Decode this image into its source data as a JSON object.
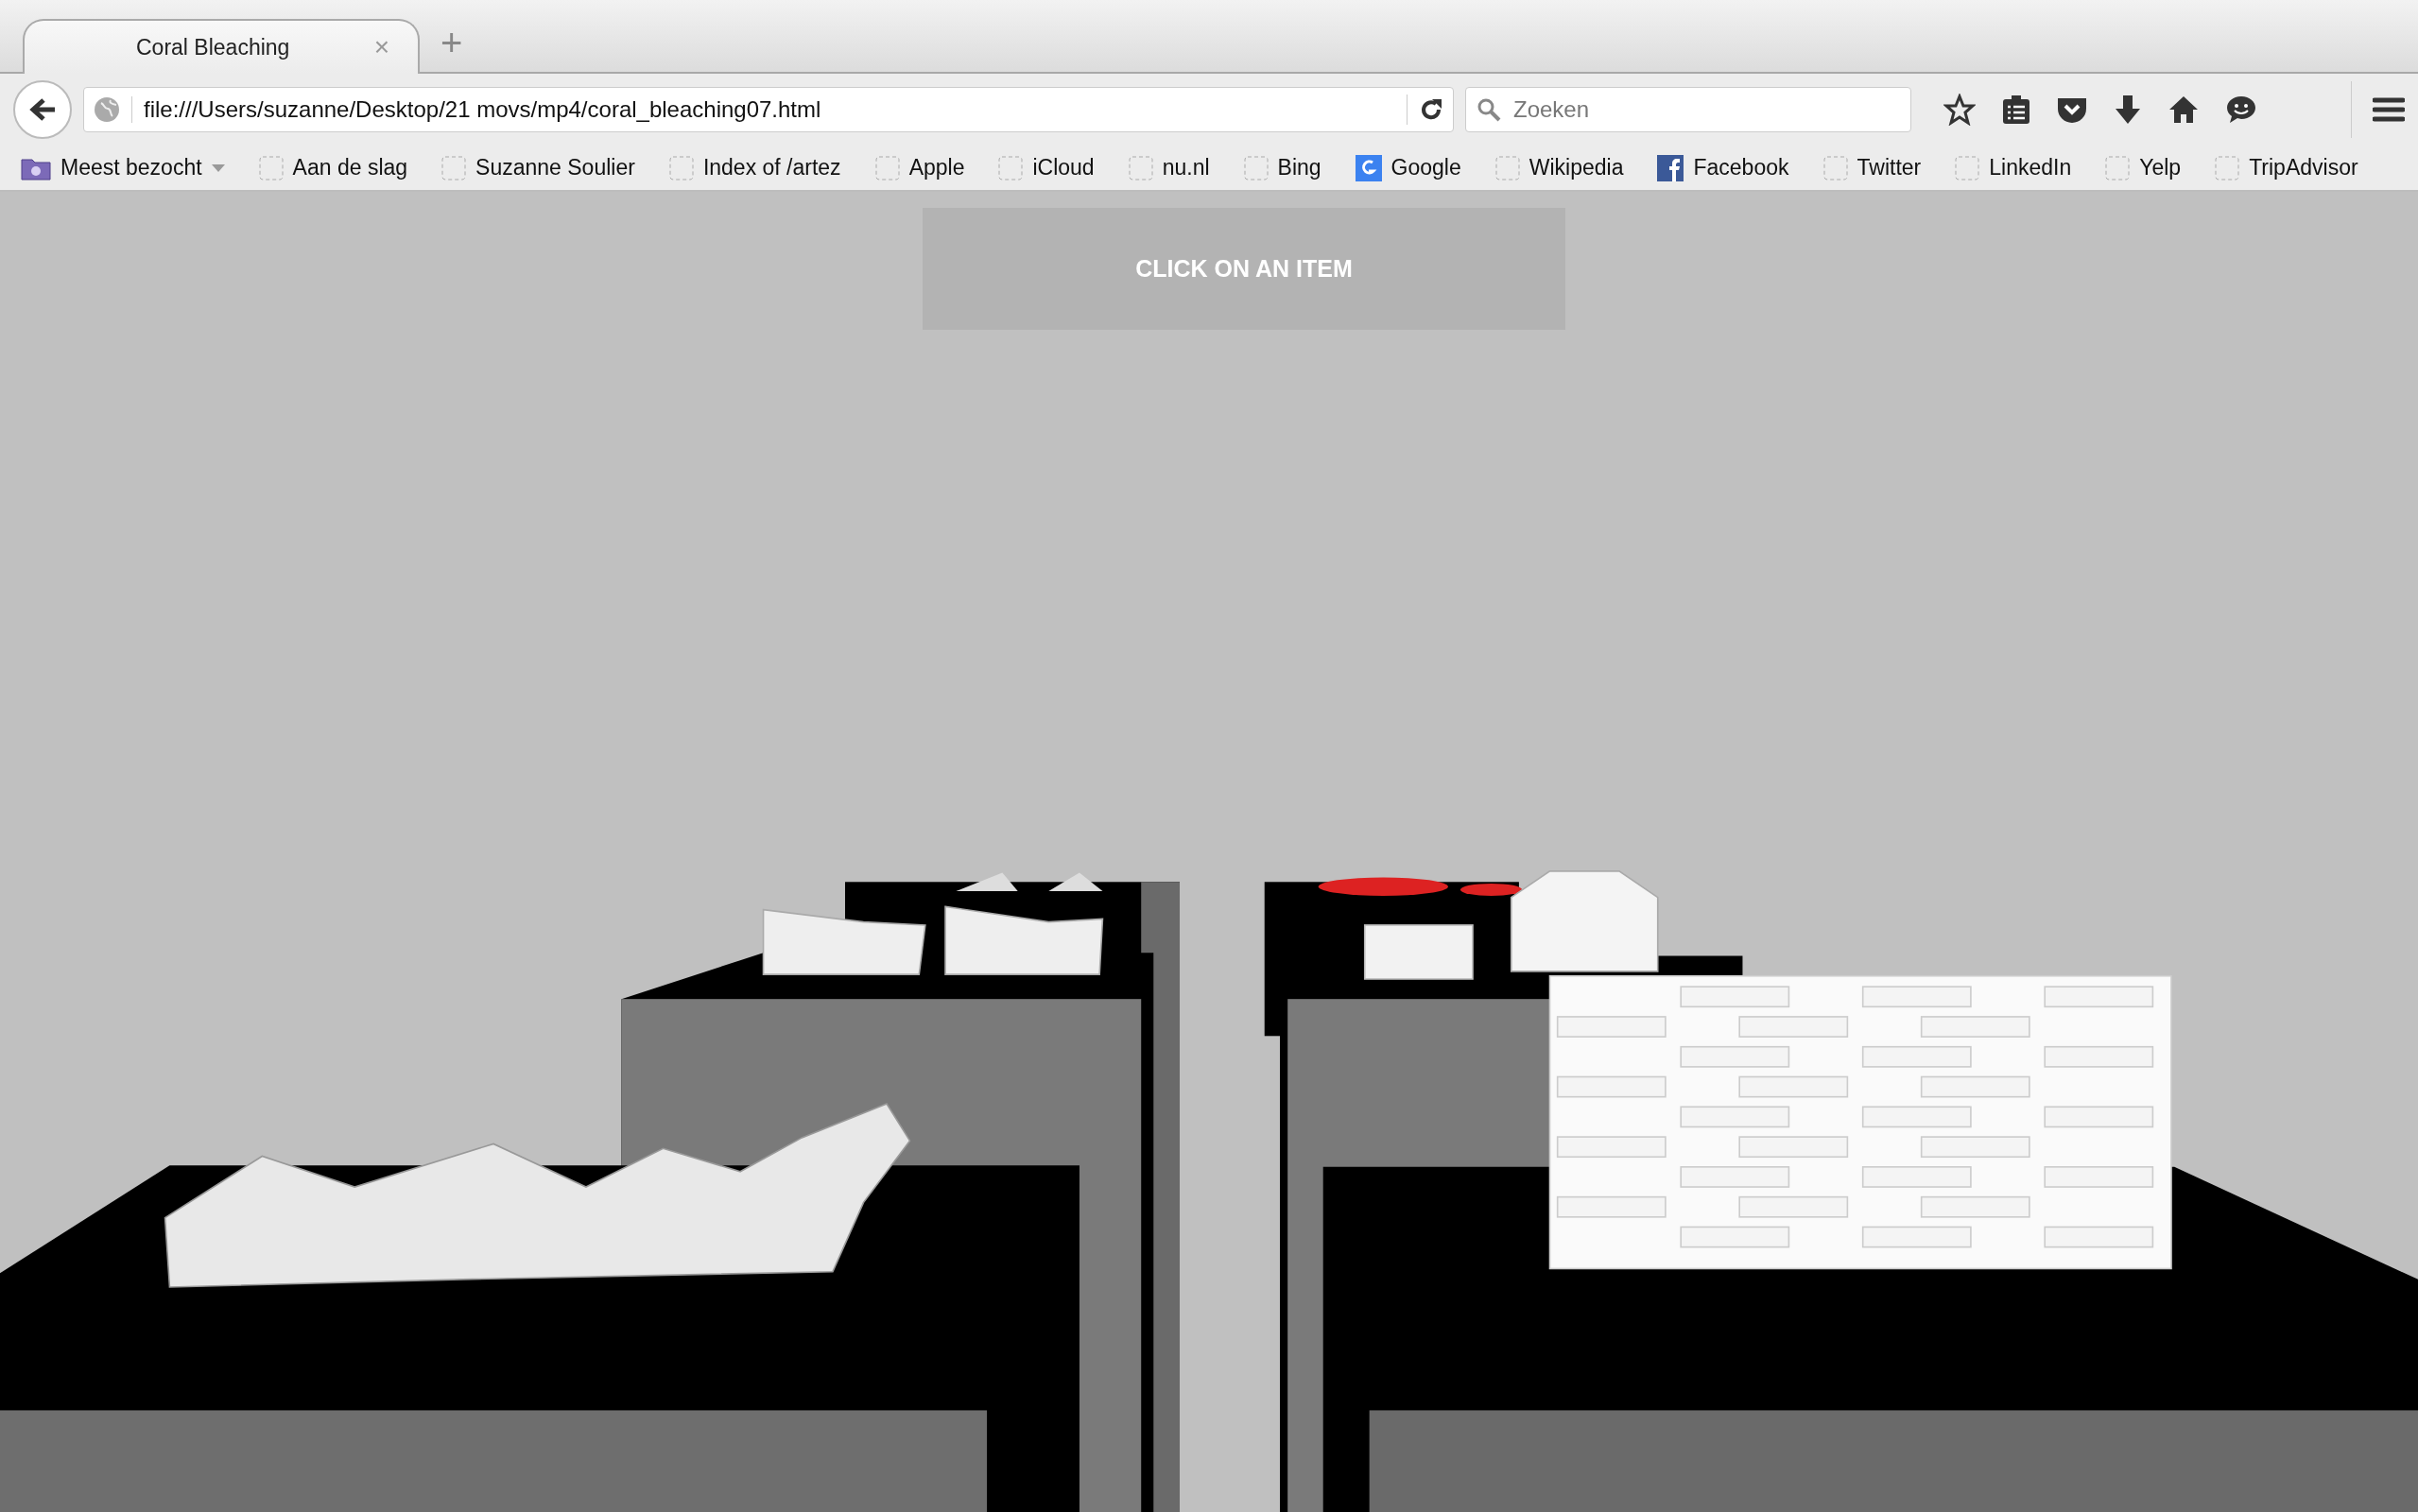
{
  "tabs": [
    {
      "title": "Coral Bleaching",
      "selected": true,
      "close": "×"
    }
  ],
  "new_tab": "+",
  "address_bar": {
    "value": "file:///Users/suzanne/Desktop/21 movs/mp4/coral_bleaching07.html"
  },
  "search": {
    "placeholder": "Zoeken"
  },
  "bookmarks": [
    {
      "label": "Meest bezocht",
      "kind": "folder"
    },
    {
      "label": "Aan de slag",
      "kind": "blank"
    },
    {
      "label": "Suzanne Soulier",
      "kind": "blank"
    },
    {
      "label": "Index of /artez",
      "kind": "blank"
    },
    {
      "label": "Apple",
      "kind": "blank"
    },
    {
      "label": "iCloud",
      "kind": "blank"
    },
    {
      "label": "nu.nl",
      "kind": "blank"
    },
    {
      "label": "Bing",
      "kind": "blank"
    },
    {
      "label": "Google",
      "kind": "google"
    },
    {
      "label": "Wikipedia",
      "kind": "blank"
    },
    {
      "label": "Facebook",
      "kind": "facebook"
    },
    {
      "label": "Twitter",
      "kind": "blank"
    },
    {
      "label": "LinkedIn",
      "kind": "blank"
    },
    {
      "label": "Yelp",
      "kind": "blank"
    },
    {
      "label": "TripAdvisor",
      "kind": "blank"
    }
  ],
  "page": {
    "banner": "CLICK ON AN ITEM"
  }
}
